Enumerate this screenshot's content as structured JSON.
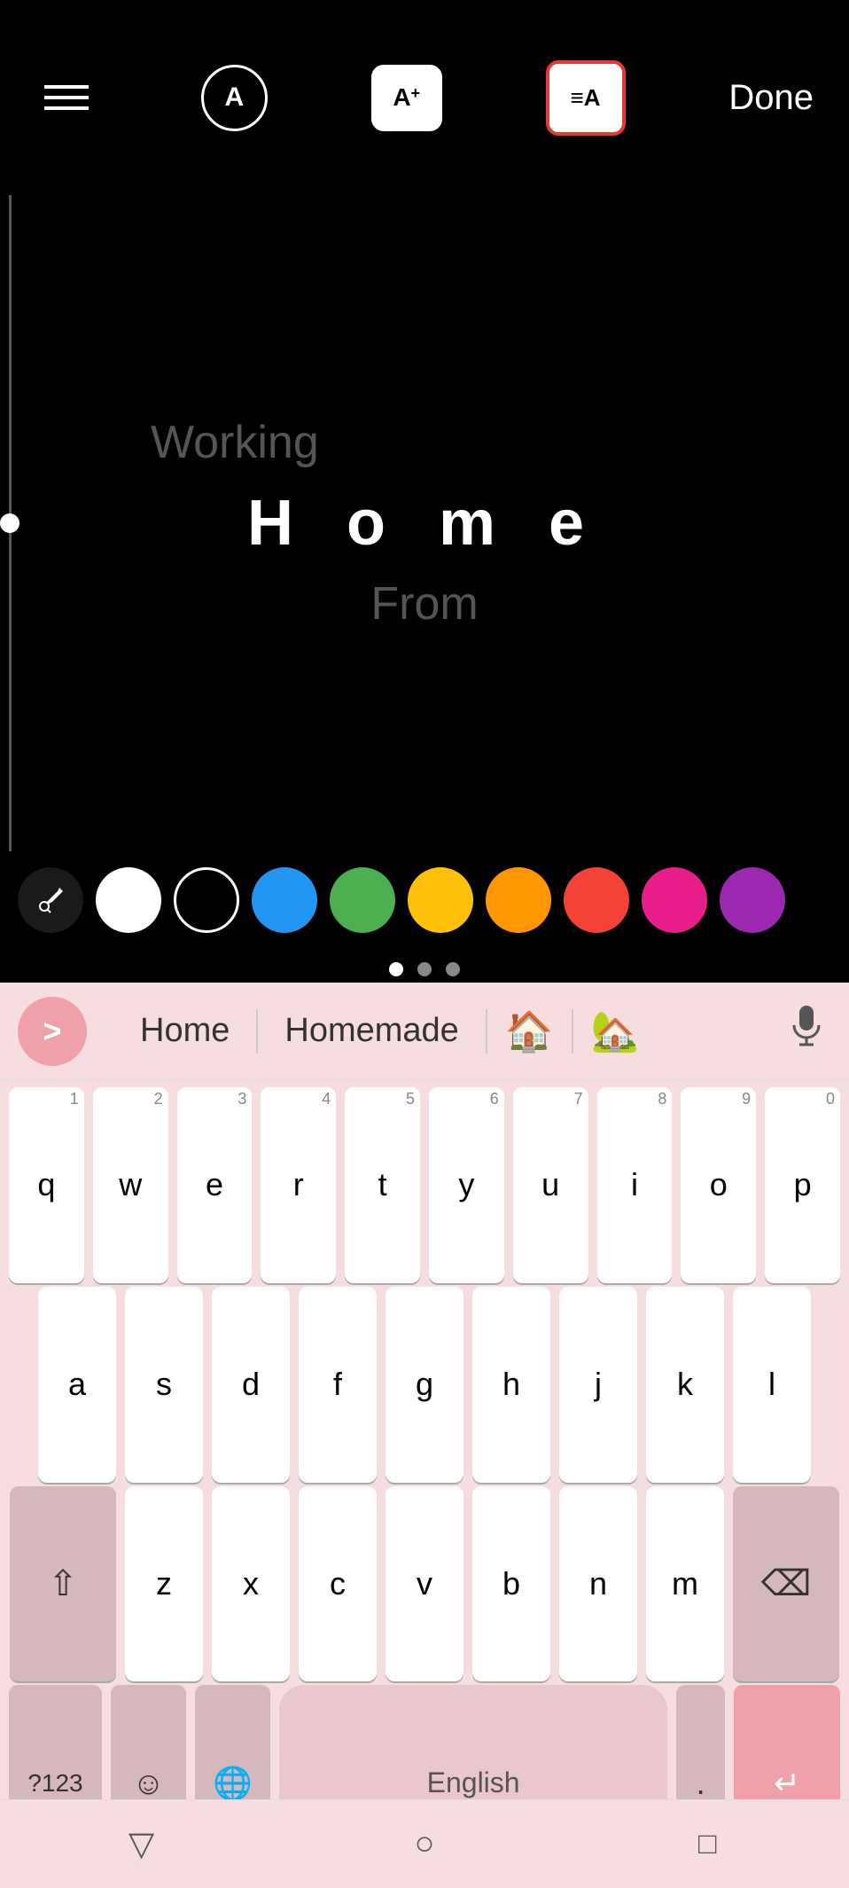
{
  "toolbar": {
    "menu_label": "☰",
    "font_a_label": "A",
    "font_ap_label": "A⁺",
    "format_label": "≡A",
    "done_label": "Done"
  },
  "canvas": {
    "line1": "Working",
    "line2": "H o m e",
    "line3": "From"
  },
  "colors": [
    {
      "name": "eyedropper",
      "bg": "#1a1a1a"
    },
    {
      "name": "white",
      "bg": "#ffffff"
    },
    {
      "name": "transparent",
      "bg": "transparent"
    },
    {
      "name": "blue",
      "bg": "#2196f3"
    },
    {
      "name": "green",
      "bg": "#4caf50"
    },
    {
      "name": "yellow",
      "bg": "#ffc107"
    },
    {
      "name": "orange",
      "bg": "#ff9800"
    },
    {
      "name": "red",
      "bg": "#f44336"
    },
    {
      "name": "pink",
      "bg": "#e91e8c"
    },
    {
      "name": "purple",
      "bg": "#9c27b0"
    }
  ],
  "suggestions": {
    "arrow": ">",
    "word1": "Home",
    "word2": "Homemade",
    "emoji1": "🏠",
    "emoji2": "🏡"
  },
  "keyboard": {
    "rows": [
      [
        {
          "letter": "q",
          "num": "1"
        },
        {
          "letter": "w",
          "num": "2"
        },
        {
          "letter": "e",
          "num": "3"
        },
        {
          "letter": "r",
          "num": "4"
        },
        {
          "letter": "t",
          "num": "5"
        },
        {
          "letter": "y",
          "num": "6"
        },
        {
          "letter": "u",
          "num": "7"
        },
        {
          "letter": "i",
          "num": "8"
        },
        {
          "letter": "o",
          "num": "9"
        },
        {
          "letter": "p",
          "num": "0"
        }
      ],
      [
        {
          "letter": "a",
          "num": ""
        },
        {
          "letter": "s",
          "num": ""
        },
        {
          "letter": "d",
          "num": ""
        },
        {
          "letter": "f",
          "num": ""
        },
        {
          "letter": "g",
          "num": ""
        },
        {
          "letter": "h",
          "num": ""
        },
        {
          "letter": "j",
          "num": ""
        },
        {
          "letter": "k",
          "num": ""
        },
        {
          "letter": "l",
          "num": ""
        }
      ],
      [
        {
          "letter": "z",
          "num": ""
        },
        {
          "letter": "x",
          "num": ""
        },
        {
          "letter": "c",
          "num": ""
        },
        {
          "letter": "v",
          "num": ""
        },
        {
          "letter": "b",
          "num": ""
        },
        {
          "letter": "n",
          "num": ""
        },
        {
          "letter": "m",
          "num": ""
        }
      ]
    ],
    "special_labels": {
      "shift": "⇧",
      "backspace": "⌫",
      "numbers": "?123",
      "emoji": "☺",
      "globe": "🌐",
      "space": "English",
      "period": ".",
      "enter": "↵"
    }
  },
  "bottom_nav": {
    "back": "▽",
    "home": "○",
    "recent": "□"
  }
}
